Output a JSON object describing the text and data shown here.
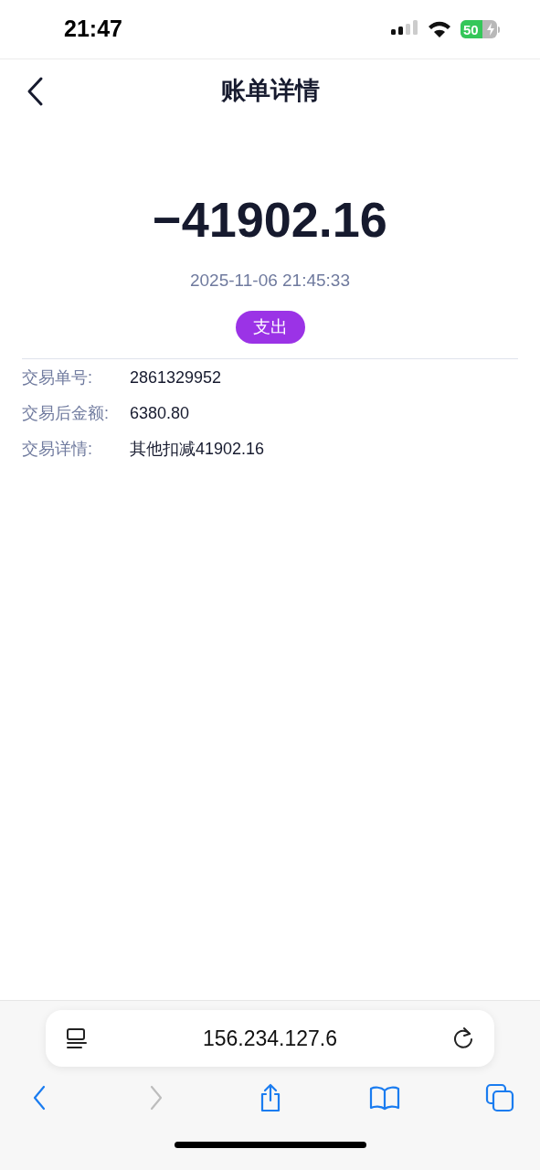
{
  "status_bar": {
    "time": "21:47",
    "battery": "50",
    "charging": true
  },
  "nav": {
    "title": "账单详情"
  },
  "amount": "−41902.16",
  "datetime": "2025-11-06 21:45:33",
  "type_badge": "支出",
  "details": [
    {
      "label": "交易单号:",
      "value": "2861329952"
    },
    {
      "label": "交易后金额:",
      "value": "6380.80"
    },
    {
      "label": "交易详情:",
      "value": "其他扣减41902.16"
    }
  ],
  "browser": {
    "address": "156.234.127.6",
    "toolbar": [
      {
        "kind": "back",
        "disabled": false
      },
      {
        "kind": "forward",
        "disabled": true
      },
      {
        "kind": "share",
        "disabled": false
      },
      {
        "kind": "bookmarks",
        "disabled": false
      },
      {
        "kind": "tabs",
        "disabled": false
      }
    ]
  }
}
